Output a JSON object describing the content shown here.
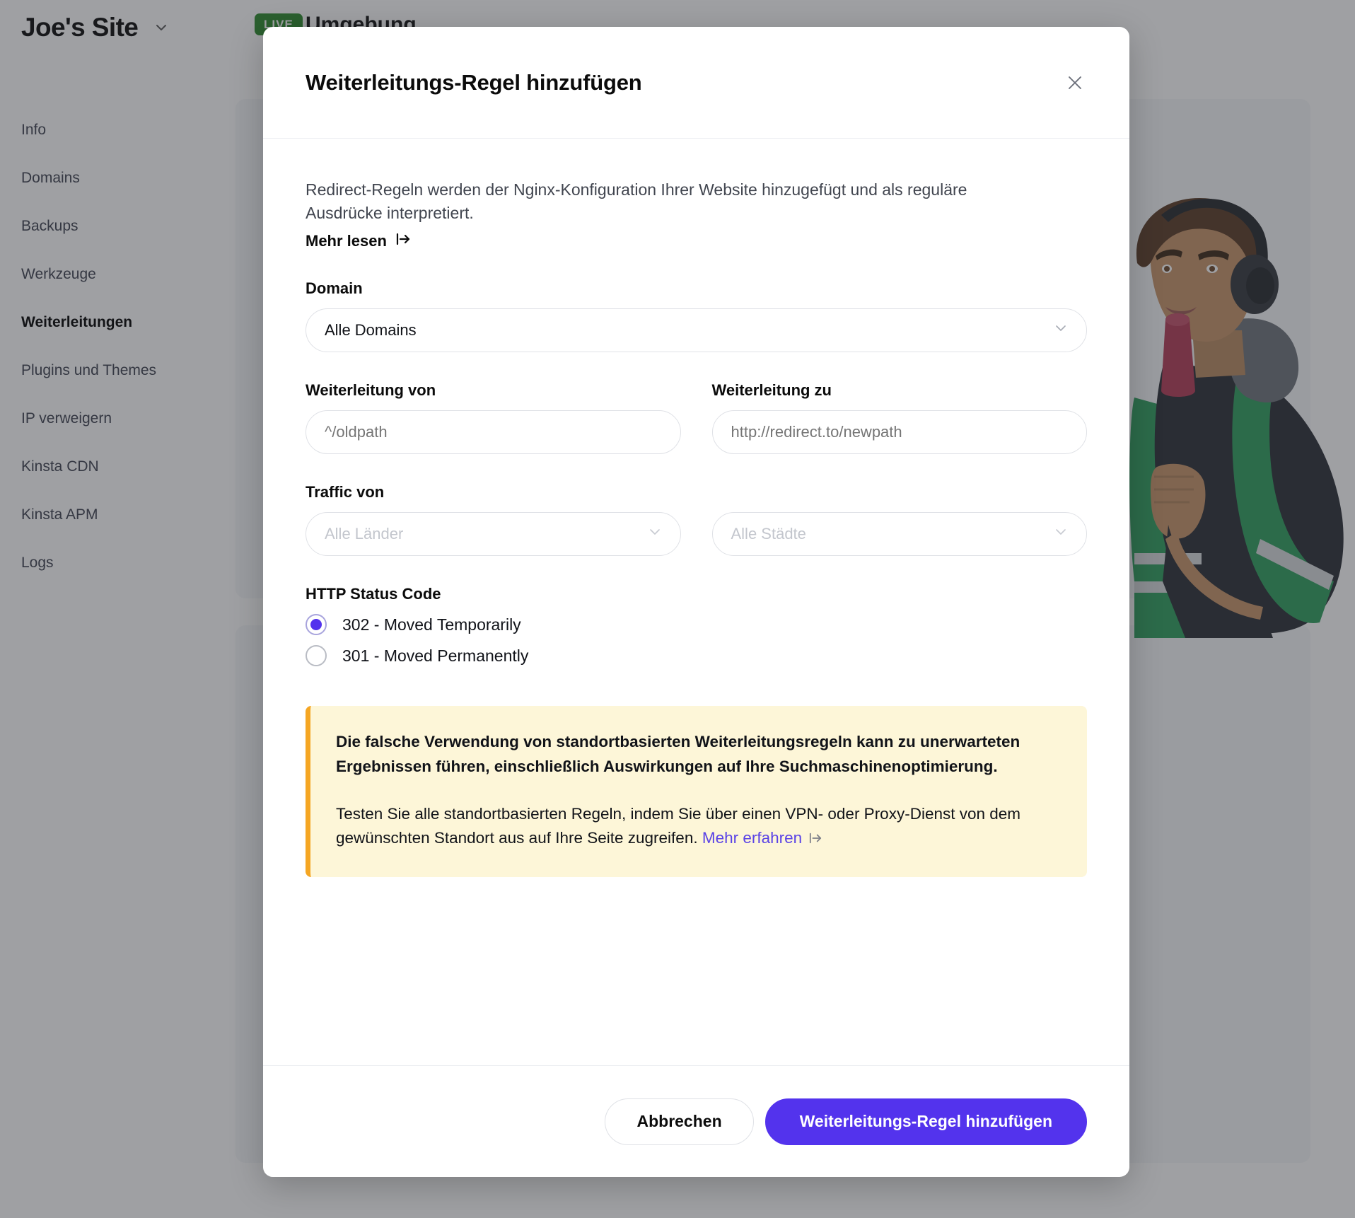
{
  "sidebar": {
    "site_title": "Joe's Site",
    "site_title_chevron_icon": "chevron-down-icon",
    "items": [
      {
        "label": "Info",
        "active": false
      },
      {
        "label": "Domains",
        "active": false
      },
      {
        "label": "Backups",
        "active": false
      },
      {
        "label": "Werkzeuge",
        "active": false
      },
      {
        "label": "Weiterleitungen",
        "active": true
      },
      {
        "label": "Plugins und Themes",
        "active": false
      },
      {
        "label": "IP verweigern",
        "active": false
      },
      {
        "label": "Kinsta CDN",
        "active": false
      },
      {
        "label": "Kinsta APM",
        "active": false
      },
      {
        "label": "Logs",
        "active": false
      }
    ]
  },
  "background": {
    "live_badge": "LIVE",
    "page_heading": "Umgebung",
    "illustration_name": "person-with-headphones-and-microphone-illustration"
  },
  "modal": {
    "title": "Weiterleitungs-Regel hinzufügen",
    "close_icon": "close-icon",
    "intro": "Redirect-Regeln werden der Nginx-Konfiguration Ihrer Website hinzugefügt und als reguläre Ausdrücke interpretiert.",
    "more_read_label": "Mehr lesen",
    "more_read_icon": "external-link-arrow-icon",
    "domain": {
      "label": "Domain",
      "value": "Alle Domains",
      "chevron_icon": "chevron-down-icon"
    },
    "redirect_from": {
      "label": "Weiterleitung von",
      "value": "",
      "placeholder": "^/oldpath"
    },
    "redirect_to": {
      "label": "Weiterleitung zu",
      "value": "",
      "placeholder": "http://redirect.to/newpath"
    },
    "traffic_from": {
      "label": "Traffic von",
      "countries": {
        "value": "",
        "placeholder": "Alle Länder",
        "chevron_icon": "chevron-down-icon"
      },
      "cities": {
        "value": "",
        "placeholder": "Alle Städte",
        "chevron_icon": "chevron-down-icon"
      }
    },
    "status_code": {
      "label": "HTTP Status Code",
      "options": [
        {
          "label": "302 - Moved Temporarily",
          "checked": true
        },
        {
          "label": "301 - Moved Permanently",
          "checked": false
        }
      ]
    },
    "warning": {
      "paragraph_1": "Die falsche Verwendung von standortbasierten Weiterleitungsregeln kann zu unerwarteten Ergebnissen führen, einschließlich Auswirkungen auf Ihre Suchmaschinenoptimierung.",
      "paragraph_2_before": "Testen Sie alle standortbasierten Regeln, indem Sie über einen VPN- oder Proxy-Dienst von dem gewünschten Standort aus auf Ihre Seite zugreifen.",
      "link_label": "Mehr erfahren",
      "link_icon": "external-link-arrow-icon"
    },
    "footer": {
      "cancel_label": "Abbrechen",
      "submit_label": "Weiterleitungs-Regel hinzufügen"
    }
  },
  "colors": {
    "accent_purple": "#5333ed",
    "warning_bg": "#fdf6d8",
    "warning_border": "#f5a623",
    "live_green": "#2c8a2c",
    "link_purple": "#5a43e6"
  }
}
